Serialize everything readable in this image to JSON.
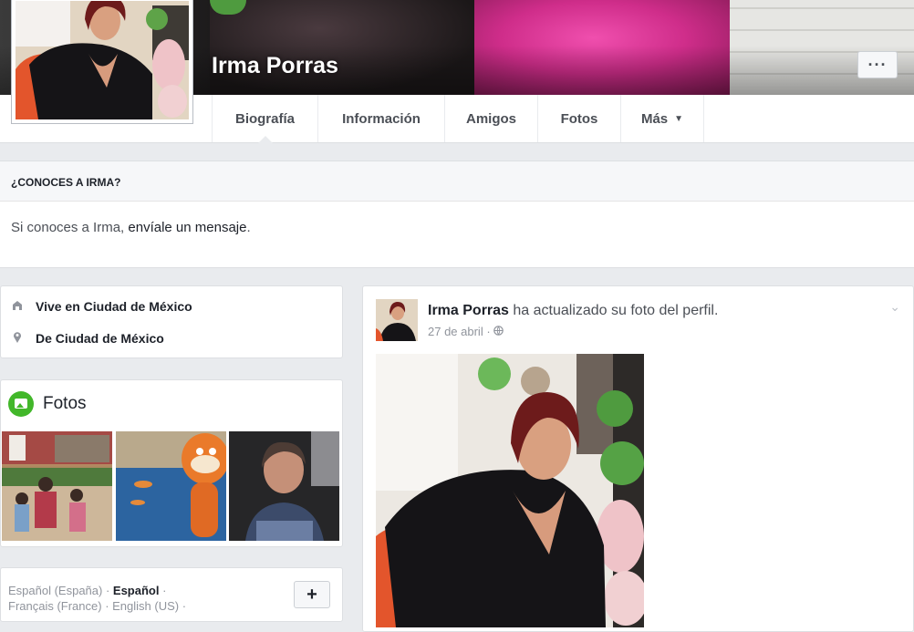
{
  "profile": {
    "name": "Irma Porras",
    "more_label": "···"
  },
  "nav": {
    "tabs": [
      {
        "label": "Biografía"
      },
      {
        "label": "Información"
      },
      {
        "label": "Amigos"
      },
      {
        "label": "Fotos"
      },
      {
        "label": "Más",
        "caret": "▼"
      }
    ]
  },
  "know": {
    "heading": "¿CONOCES A IRMA?",
    "prefix": "Si conoces a Irma, ",
    "link": "envíale un mensaje",
    "suffix": "."
  },
  "intro": {
    "items": [
      {
        "icon": "home-icon",
        "text": "Vive en Ciudad de México"
      },
      {
        "icon": "location-pin-icon",
        "text": "De Ciudad de México"
      }
    ]
  },
  "photos": {
    "title": "Fotos",
    "icon": "photo-album-icon"
  },
  "languages": {
    "l1": "Español (España)",
    "sep1": " · ",
    "l2": "Español",
    "sep2": " · ",
    "l3": "Français (France)",
    "sep3": " · ",
    "l4": "English (US)",
    "sep4": " ·",
    "add_label": "+"
  },
  "post": {
    "author": "Irma Porras",
    "action": " ha actualizado su foto del perfil.",
    "date": "27 de abril",
    "separator": " · ",
    "privacy_icon": "globe-icon",
    "chevron": "⌄"
  },
  "colors": {
    "brand_pink": "#d8348f",
    "accent_green": "#42b72a",
    "link_dark": "#1d2129"
  }
}
